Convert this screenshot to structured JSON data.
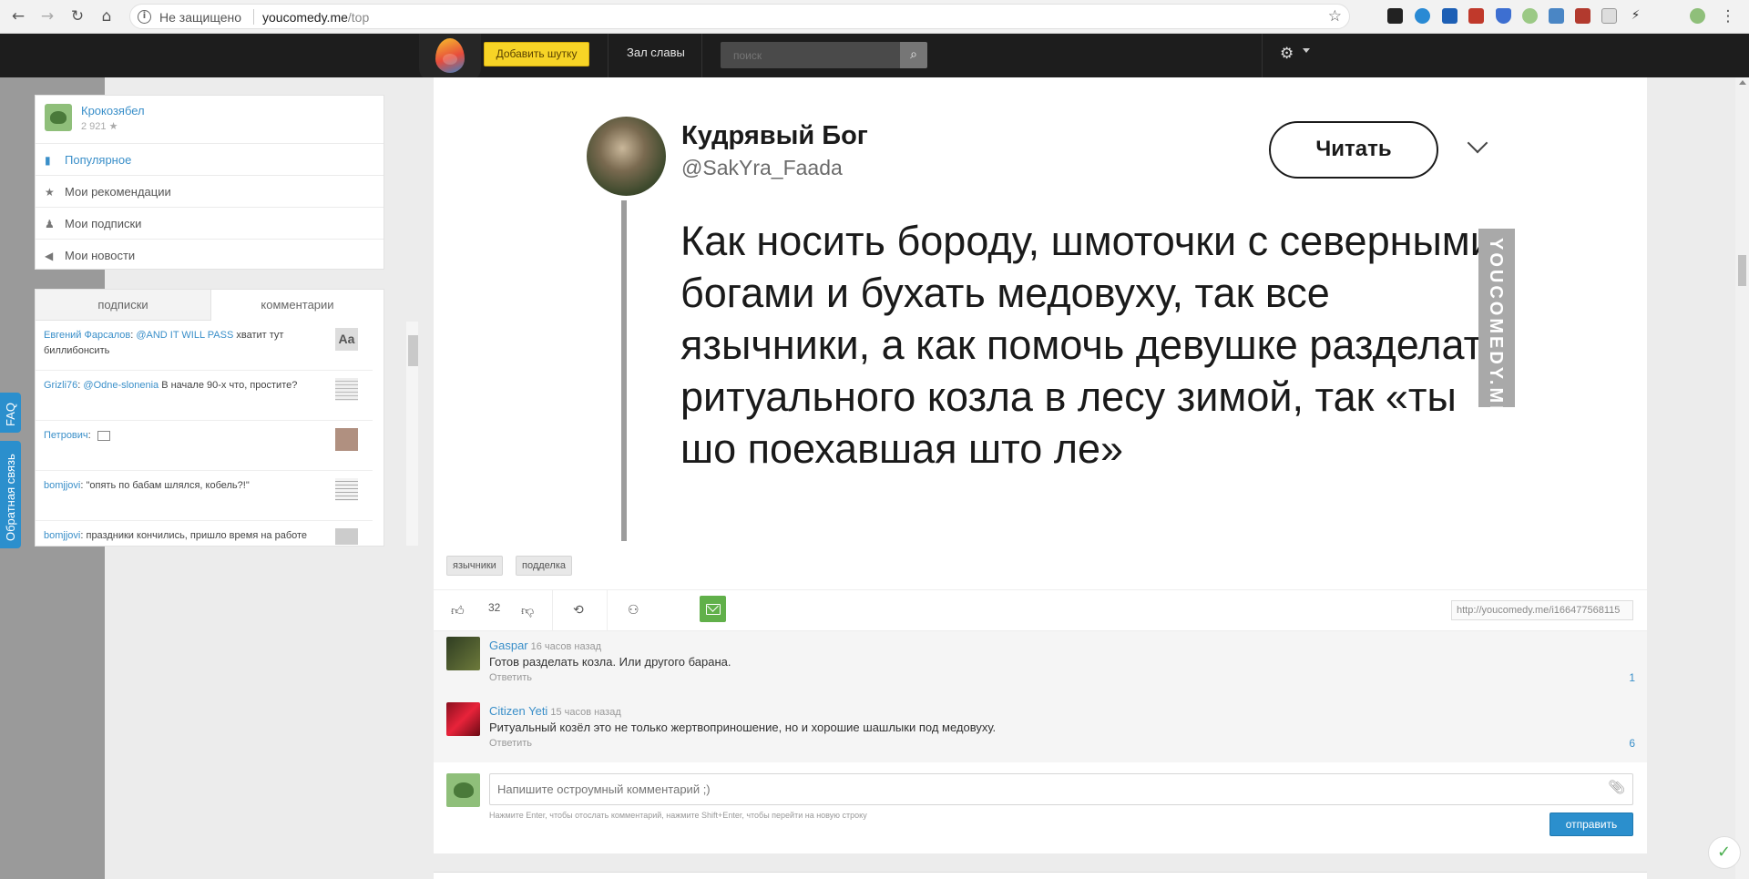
{
  "browser": {
    "security_label": "Не защищено",
    "url_host": "youcomedy.me",
    "url_path": "/top"
  },
  "header": {
    "add_joke_label": "Добавить шутку",
    "hall_of_fame_label": "Зал славы",
    "search_placeholder": "поиск"
  },
  "user": {
    "name": "Крокозябел",
    "rating": "2 921 ★"
  },
  "menu": [
    {
      "label": "Популярное",
      "icon": "bar-chart-icon"
    },
    {
      "label": "Мои рекомендации",
      "icon": "star-icon"
    },
    {
      "label": "Мои подписки",
      "icon": "users-icon"
    },
    {
      "label": "Мои новости",
      "icon": "megaphone-icon"
    }
  ],
  "comments_widget": {
    "tab_subscriptions": "подписки",
    "tab_comments": "комментарии",
    "items": [
      {
        "author": "Евгений Фарсалов",
        "mention": "@AND IT WILL PASS",
        "text": "хватит тут биллибонсить"
      },
      {
        "author": "Grizli76",
        "mention": "@Odne-slonenia",
        "text": "В начале 90-х что, простите?"
      },
      {
        "author": "Петрович",
        "mention": "",
        "text": ""
      },
      {
        "author": "bomjjovi",
        "mention": "",
        "text": "\"опять по бабам шлялся, кобель?!\""
      },
      {
        "author": "bomjjovi",
        "mention": "",
        "text": "праздники кончились, пришло время на работе"
      }
    ]
  },
  "side_tabs": {
    "faq": "FAQ",
    "feedback": "Обратная связь"
  },
  "post": {
    "tweet_name": "Кудрявый Бог",
    "tweet_handle": "@SakYra_Faada",
    "tweet_read": "Читать",
    "tweet_text": "Как носить бороду, шмоточки с северными богами и бухать медовуху, так все язычники, а как помочь девушке разделать ритуального козла в лесу зимой, так «ты шо поехавшая што ле»",
    "watermark": "YOUCOMEDY.ME",
    "tags": [
      "язычники",
      "подделка"
    ],
    "votes": "32",
    "link": "http://youcomedy.me/i166477568115"
  },
  "comments": [
    {
      "author": "Gaspar",
      "time": "16 часов назад",
      "text": "Готов разделать козла. Или другого барана.",
      "reply": "Ответить",
      "count": "1"
    },
    {
      "author": "Citizen Yeti",
      "time": "15 часов назад",
      "text": "Ритуальный козёл это не только жертвоприношение, но и хорошие шашлыки под медовуху.",
      "reply": "Ответить",
      "count": "6"
    }
  ],
  "comment_form": {
    "placeholder": "Напишите остроумный комментарий ;)",
    "hint": "Нажмите Enter, чтобы отослать комментарий, нажмите Shift+Enter, чтобы перейти на новую строку",
    "send_label": "отправить"
  },
  "colors": {
    "accent": "#2b8fcd",
    "add_button": "#f7d426",
    "header_bg": "#1d1d1d"
  }
}
